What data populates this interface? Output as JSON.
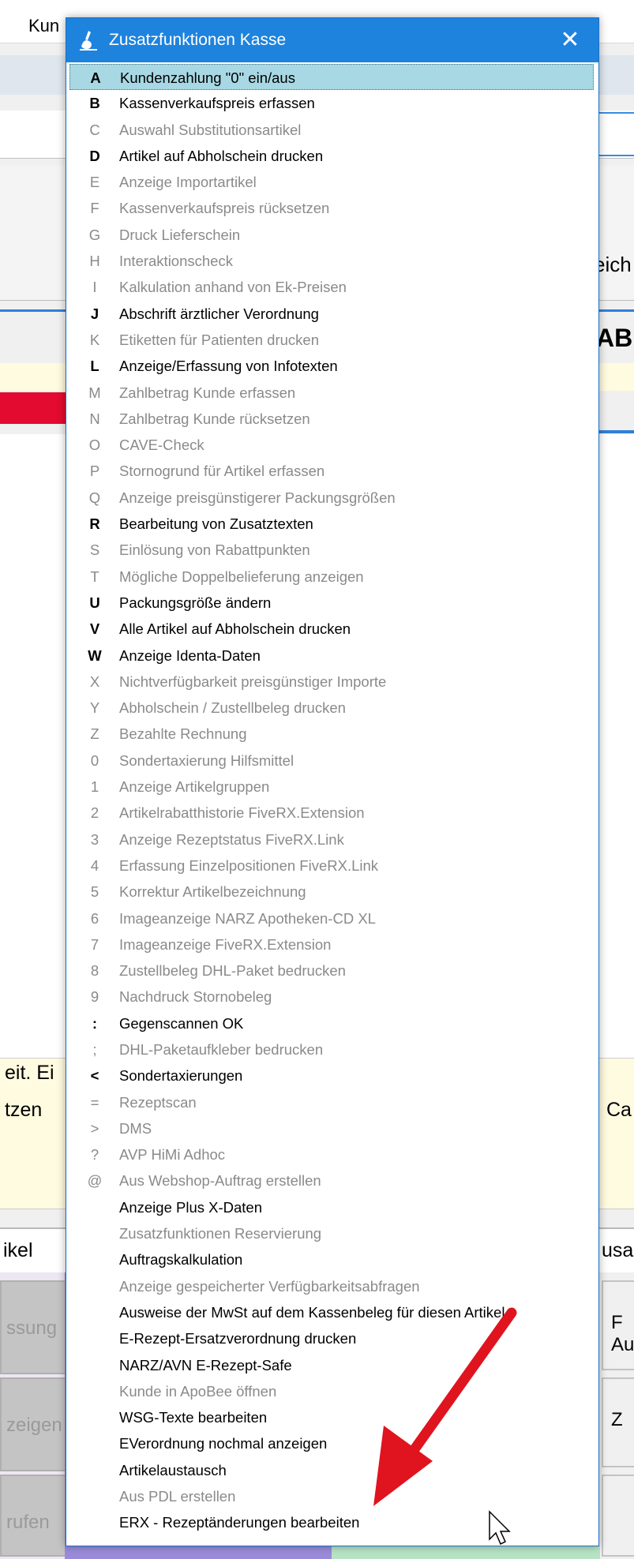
{
  "background": {
    "menubar_fragment": "Kun",
    "right_fragment_1": "eich",
    "right_fragment_2": "AB",
    "left_fragment_1": "eit. Ei",
    "left_fragment_2": "tzen",
    "right_fragment_3": "Ca",
    "row_left": "ikel",
    "row_right": "usa",
    "side_buttons": [
      "ssung",
      "zeigen",
      "rufen"
    ],
    "right_buttons": [
      "F Au",
      "Z",
      ""
    ]
  },
  "dialog": {
    "title": "Zusatzfunktionen Kasse",
    "close_label": "✕",
    "items": [
      {
        "key": "A",
        "label": "Kundenzahlung \"0\" ein/aus",
        "enabled": true,
        "selected": true
      },
      {
        "key": "B",
        "label": "Kassenverkaufspreis erfassen",
        "enabled": true
      },
      {
        "key": "C",
        "label": "Auswahl Substitutionsartikel",
        "enabled": false
      },
      {
        "key": "D",
        "label": "Artikel auf Abholschein drucken",
        "enabled": true
      },
      {
        "key": "E",
        "label": "Anzeige Importartikel",
        "enabled": false
      },
      {
        "key": "F",
        "label": "Kassenverkaufspreis rücksetzen",
        "enabled": false
      },
      {
        "key": "G",
        "label": "Druck Lieferschein",
        "enabled": false
      },
      {
        "key": "H",
        "label": "Interaktionscheck",
        "enabled": false
      },
      {
        "key": "I",
        "label": "Kalkulation anhand von Ek-Preisen",
        "enabled": false
      },
      {
        "key": "J",
        "label": "Abschrift ärztlicher Verordnung",
        "enabled": true
      },
      {
        "key": "K",
        "label": "Etiketten für Patienten drucken",
        "enabled": false
      },
      {
        "key": "L",
        "label": "Anzeige/Erfassung von Infotexten",
        "enabled": true
      },
      {
        "key": "M",
        "label": "Zahlbetrag Kunde erfassen",
        "enabled": false
      },
      {
        "key": "N",
        "label": "Zahlbetrag Kunde rücksetzen",
        "enabled": false
      },
      {
        "key": "O",
        "label": "CAVE-Check",
        "enabled": false
      },
      {
        "key": "P",
        "label": "Stornogrund für Artikel erfassen",
        "enabled": false
      },
      {
        "key": "Q",
        "label": "Anzeige preisgünstigerer Packungsgrößen",
        "enabled": false
      },
      {
        "key": "R",
        "label": "Bearbeitung von Zusatztexten",
        "enabled": true
      },
      {
        "key": "S",
        "label": "Einlösung von Rabattpunkten",
        "enabled": false
      },
      {
        "key": "T",
        "label": "Mögliche Doppelbelieferung anzeigen",
        "enabled": false
      },
      {
        "key": "U",
        "label": "Packungsgröße ändern",
        "enabled": true
      },
      {
        "key": "V",
        "label": "Alle Artikel auf Abholschein drucken",
        "enabled": true
      },
      {
        "key": "W",
        "label": "Anzeige Identa-Daten",
        "enabled": true
      },
      {
        "key": "X",
        "label": "Nichtverfügbarkeit preisgünstiger Importe",
        "enabled": false
      },
      {
        "key": "Y",
        "label": "Abholschein / Zustellbeleg drucken",
        "enabled": false
      },
      {
        "key": "Z",
        "label": "Bezahlte Rechnung",
        "enabled": false
      },
      {
        "key": "0",
        "label": "Sondertaxierung Hilfsmittel",
        "enabled": false
      },
      {
        "key": "1",
        "label": "Anzeige Artikelgruppen",
        "enabled": false
      },
      {
        "key": "2",
        "label": "Artikelrabatthistorie FiveRX.Extension",
        "enabled": false
      },
      {
        "key": "3",
        "label": "Anzeige Rezeptstatus FiveRX.Link",
        "enabled": false
      },
      {
        "key": "4",
        "label": "Erfassung Einzelpositionen FiveRX.Link",
        "enabled": false
      },
      {
        "key": "5",
        "label": "Korrektur Artikelbezeichnung",
        "enabled": false
      },
      {
        "key": "6",
        "label": "Imageanzeige NARZ Apotheken-CD XL",
        "enabled": false
      },
      {
        "key": "7",
        "label": "Imageanzeige FiveRX.Extension",
        "enabled": false
      },
      {
        "key": "8",
        "label": "Zustellbeleg DHL-Paket bedrucken",
        "enabled": false
      },
      {
        "key": "9",
        "label": "Nachdruck Stornobeleg",
        "enabled": false
      },
      {
        "key": ":",
        "label": "Gegenscannen OK",
        "enabled": true
      },
      {
        "key": ";",
        "label": "DHL-Paketaufkleber bedrucken",
        "enabled": false
      },
      {
        "key": "<",
        "label": "Sondertaxierungen",
        "enabled": true
      },
      {
        "key": "=",
        "label": "Rezeptscan",
        "enabled": false
      },
      {
        "key": ">",
        "label": "DMS",
        "enabled": false
      },
      {
        "key": "?",
        "label": "AVP HiMi Adhoc",
        "enabled": false
      },
      {
        "key": "@",
        "label": "Aus Webshop-Auftrag erstellen",
        "enabled": false
      },
      {
        "key": "",
        "label": "Anzeige Plus X-Daten",
        "enabled": true
      },
      {
        "key": "",
        "label": "Zusatzfunktionen Reservierung",
        "enabled": false
      },
      {
        "key": "",
        "label": "Auftragskalkulation",
        "enabled": true
      },
      {
        "key": "",
        "label": "Anzeige gespeicherter Verfügbarkeitsabfragen",
        "enabled": false
      },
      {
        "key": "",
        "label": "Ausweise der MwSt auf dem Kassenbeleg für diesen Artikel",
        "enabled": true
      },
      {
        "key": "",
        "label": "E-Rezept-Ersatzverordnung drucken",
        "enabled": true
      },
      {
        "key": "",
        "label": "NARZ/AVN E-Rezept-Safe",
        "enabled": true
      },
      {
        "key": "",
        "label": "Kunde in ApoBee öffnen",
        "enabled": false
      },
      {
        "key": "",
        "label": "WSG-Texte bearbeiten",
        "enabled": true
      },
      {
        "key": "",
        "label": "EVerordnung nochmal anzeigen",
        "enabled": true
      },
      {
        "key": "",
        "label": "Artikelaustausch",
        "enabled": true
      },
      {
        "key": "",
        "label": "Aus PDL erstellen",
        "enabled": false
      },
      {
        "key": "",
        "label": "ERX - Rezeptänderungen bearbeiten",
        "enabled": true
      }
    ]
  },
  "colors": {
    "titlebar": "#1e83dd",
    "selected_bg": "#a7d8e3",
    "enabled_text": "#000000",
    "disabled_text": "#8a8a8a",
    "arrow": "#e0141e"
  }
}
